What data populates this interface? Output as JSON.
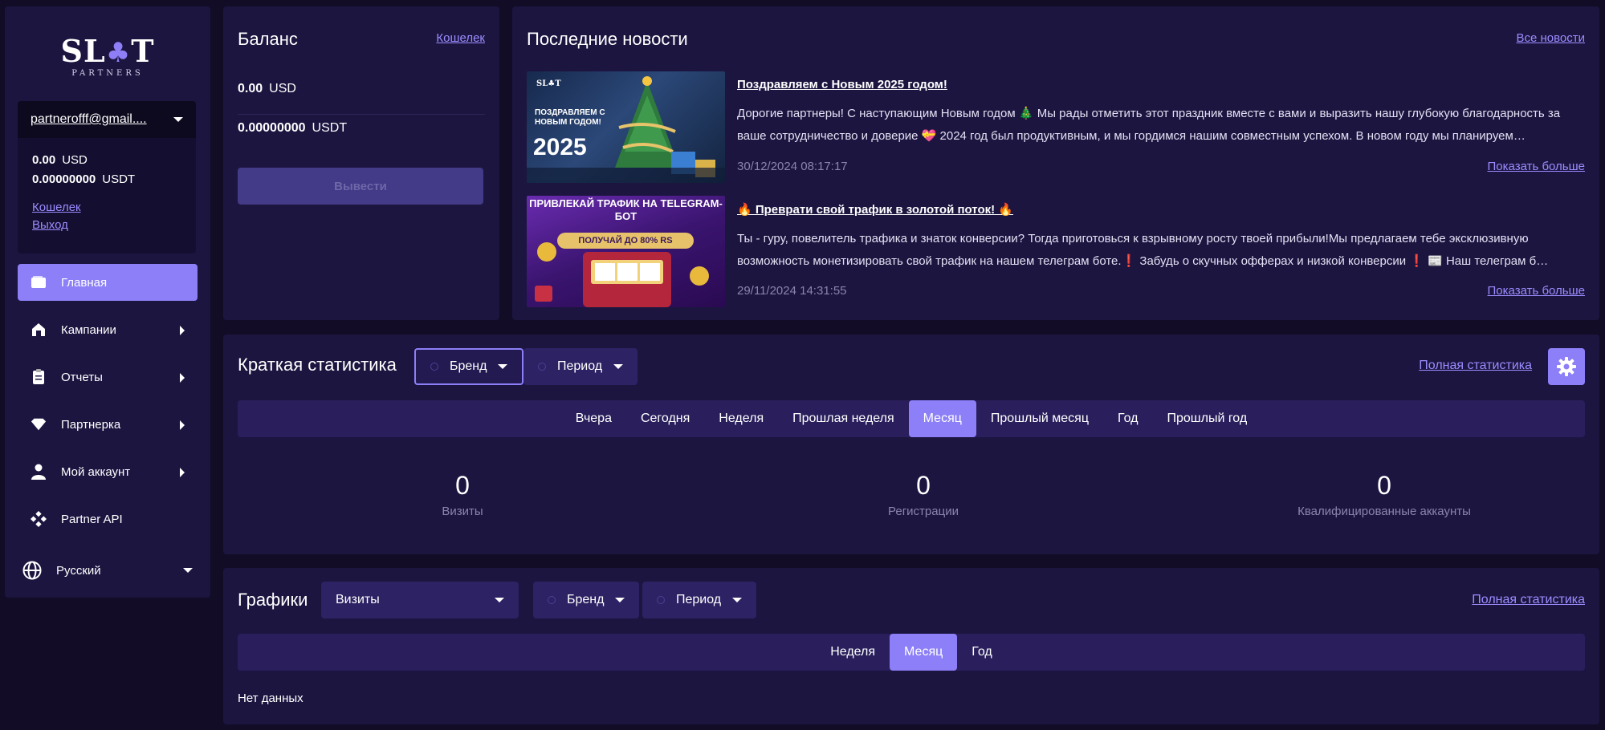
{
  "colors": {
    "accent": "#8c7ff8",
    "card": "#1c1540",
    "page": "#120c26",
    "muted": "#8b84ac"
  },
  "logo": {
    "main_left": "SL",
    "main_suit": "♣",
    "main_right": "T",
    "sub": "PARTNERS"
  },
  "account": {
    "email": "partnerofff@gmail....",
    "balances": [
      {
        "amount": "0.00",
        "currency": "USD"
      },
      {
        "amount": "0.00000000",
        "currency": "USDT"
      }
    ],
    "wallet_link": "Кошелек",
    "logout_link": "Выход"
  },
  "nav": [
    {
      "label": "Главная",
      "icon": "wallet-icon",
      "active": true
    },
    {
      "label": "Кампании",
      "icon": "store-icon"
    },
    {
      "label": "Отчеты",
      "icon": "clipboard-icon"
    },
    {
      "label": "Партнерка",
      "icon": "diamond-icon"
    },
    {
      "label": "Мой аккаунт",
      "icon": "user-icon"
    },
    {
      "label": "Partner API",
      "icon": "api-icon"
    }
  ],
  "language": {
    "label": "Русский",
    "icon": "globe-icon"
  },
  "balance_card": {
    "title": "Баланс",
    "wallet_link": "Кошелек",
    "rows": [
      {
        "amount": "0.00",
        "currency": "USD"
      },
      {
        "amount": "0.00000000",
        "currency": "USDT"
      }
    ],
    "withdraw_label": "Вывести"
  },
  "news_card": {
    "title": "Последние новости",
    "all_link": "Все новости",
    "items": [
      {
        "title": "Поздравляем с Новым 2025 годом!",
        "text": "Дорогие партнеры! С наступающим Новым годом 🎄 Мы рады отметить этот праздник вместе с вами и выразить нашу глубокую благодарность за ваше сотрудничество и доверие 💝 2024 год был продуктивным, и мы гордимся нашим совместным успехом. В новом году мы планируем…",
        "date": "30/12/2024 08:17:17",
        "more": "Показать больше",
        "image_caption_top": "ПОЗДРАВЛЯЕМ С НОВЫМ ГОДОМ!",
        "image_caption_year": "2025"
      },
      {
        "title": "🔥 Преврати свой трафик в золотой поток! 🔥",
        "text": "Ты - гуру, повелитель трафика и знаток конверсии? Тогда приготовься к взрывному росту твоей прибыли!Мы предлагаем тебе эксклюзивную возможность монетизировать свой трафик на нашем телеграм боте.❗ Забудь о скучных офферах и низкой конверсии ❗ 📰 Наш телеграм б…",
        "date": "29/11/2024 14:31:55",
        "more": "Показать больше",
        "image_caption_top": "ПРИВЛЕКАЙ ТРАФИК НА TELEGRAM-БОТ",
        "image_caption_sub": "ПОЛУЧАЙ ДО 80% RS"
      }
    ]
  },
  "stats_card": {
    "title": "Краткая статистика",
    "brand_filter": "Бренд",
    "period_filter": "Период",
    "full_link": "Полная статистика",
    "tabs": [
      "Вчера",
      "Сегодня",
      "Неделя",
      "Прошлая неделя",
      "Месяц",
      "Прошлый месяц",
      "Год",
      "Прошлый год"
    ],
    "active_tab": "Месяц",
    "metrics": [
      {
        "value": "0",
        "label": "Визиты"
      },
      {
        "value": "0",
        "label": "Регистрации"
      },
      {
        "value": "0",
        "label": "Квалифицированные аккаунты"
      }
    ]
  },
  "charts_card": {
    "title": "Графики",
    "metric_select": "Визиты",
    "brand_filter": "Бренд",
    "period_filter": "Период",
    "full_link": "Полная статистика",
    "tabs": [
      "Неделя",
      "Месяц",
      "Год"
    ],
    "active_tab": "Месяц",
    "no_data": "Нет данных"
  }
}
